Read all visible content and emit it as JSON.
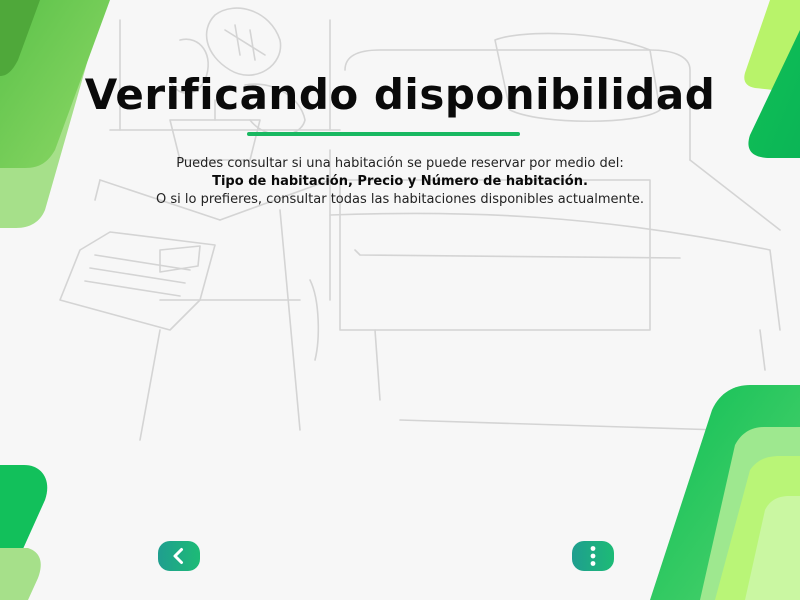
{
  "page": {
    "title": "Verificando disponibilidad",
    "description": {
      "line1": "Puedes consultar si una habitación se puede reservar por medio del:",
      "line2_bold": "Tipo de habitación, Precio y Número de habitación.",
      "line3": "O si lo prefieres, consultar todas las habitaciones disponibles actualmente."
    }
  },
  "nav": {
    "back_icon": "chevron-left-icon",
    "menu_icon": "more-vertical-icon"
  },
  "colors": {
    "accent": "#19b861",
    "green_dark": "#0fb95a",
    "green_light": "#b8f36a",
    "button_start": "#1f9e8f",
    "button_end": "#1dbb76"
  }
}
